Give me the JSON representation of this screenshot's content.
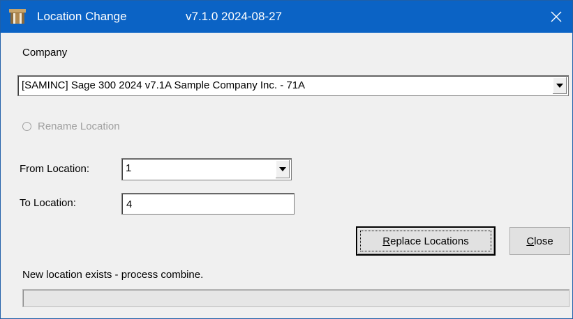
{
  "window": {
    "title": "Location Change",
    "version": "v7.1.0  2024-08-27",
    "close_glyph": "✕",
    "titlebar_color": "#0b63c5"
  },
  "company": {
    "label": "Company",
    "selected": "[SAMINC] Sage 300 2024 v7.1A Sample Company Inc.  - 71A"
  },
  "rename_option": {
    "label": "Rename Location",
    "selected": false,
    "enabled": false
  },
  "from_location": {
    "label": "From Location:",
    "selected": "1"
  },
  "to_location": {
    "label": "To Location:",
    "value": "4"
  },
  "buttons": {
    "replace_label": "Replace Locations",
    "close_label": "Close"
  },
  "status": {
    "message": "New location exists - process combine.",
    "progress": 0
  }
}
